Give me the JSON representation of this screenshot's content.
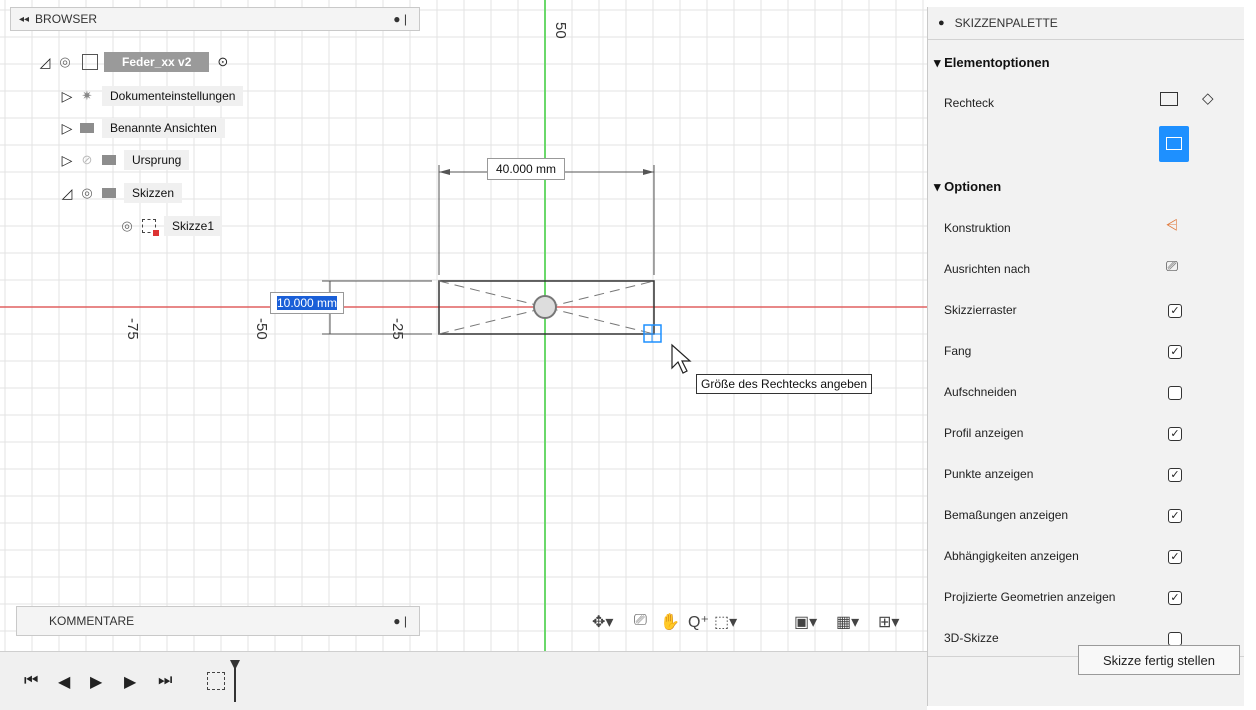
{
  "browser": {
    "title": "BROWSER",
    "items": [
      {
        "label": "Feder_xx v2"
      },
      {
        "label": "Dokumenteinstellungen"
      },
      {
        "label": "Benannte Ansichten"
      },
      {
        "label": "Ursprung"
      },
      {
        "label": "Skizzen"
      },
      {
        "label": "Skizze1"
      }
    ]
  },
  "comments": {
    "title": "KOMMENTARE"
  },
  "canvas": {
    "axis_labels": {
      "top": "50",
      "left75": "-75",
      "left50": "-50",
      "left25": "-25"
    },
    "width_dim": "40.000 mm",
    "height_dim": "10.000 mm",
    "tooltip": "Größe des Rechtecks angeben",
    "colors": {
      "x_axis": "#e06060",
      "y_axis": "#6ad86a",
      "highlight": "#1e90ff"
    }
  },
  "palette": {
    "title": "SKIZZENPALETTE",
    "section1": "Elementoptionen",
    "rechteck": "Rechteck",
    "section2": "Optionen",
    "options": [
      {
        "label": "Konstruktion"
      },
      {
        "label": "Ausrichten nach"
      },
      {
        "label": "Skizzierraster",
        "checked": true
      },
      {
        "label": "Fang",
        "checked": true
      },
      {
        "label": "Aufschneiden",
        "checked": false
      },
      {
        "label": "Profil anzeigen",
        "checked": true
      },
      {
        "label": "Punkte anzeigen",
        "checked": true
      },
      {
        "label": "Bemaßungen anzeigen",
        "checked": true
      },
      {
        "label": "Abhängigkeiten anzeigen",
        "checked": true
      },
      {
        "label": "Projizierte Geometrien anzeigen",
        "checked": true
      },
      {
        "label": "3D-Skizze",
        "checked": false
      }
    ],
    "finish_button": "Skizze fertig stellen"
  },
  "icons": [
    "pan-orbit-icon",
    "look-at-icon",
    "hand-icon",
    "zoom-icon",
    "zoom-window-icon",
    "display-icon",
    "grid-icon",
    "viewports-icon"
  ]
}
